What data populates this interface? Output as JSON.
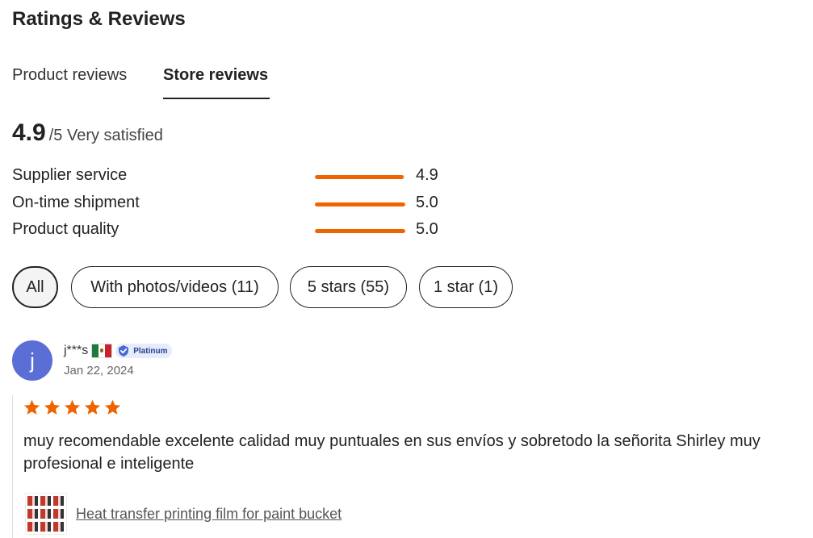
{
  "header": {
    "title": "Ratings & Reviews"
  },
  "tabs": [
    {
      "label": "Product reviews",
      "active": false
    },
    {
      "label": "Store reviews",
      "active": true
    }
  ],
  "summary": {
    "score": "4.9",
    "rest": "/5 Very satisfied"
  },
  "metrics": [
    {
      "label": "Supplier service",
      "value": "4.9",
      "fraction": 0.98
    },
    {
      "label": "On-time shipment",
      "value": "5.0",
      "fraction": 1.0
    },
    {
      "label": "Product quality",
      "value": "5.0",
      "fraction": 1.0
    }
  ],
  "filters": [
    {
      "label": "All",
      "active": true
    },
    {
      "label": "With photos/videos (11)",
      "active": false
    },
    {
      "label": "5 stars (55)",
      "active": false
    },
    {
      "label": "1 star (1)",
      "active": false
    }
  ],
  "review": {
    "avatar_letter": "j",
    "name": "j***s",
    "badge": "Platinum",
    "date": "Jan 22, 2024",
    "stars": 5,
    "text": "muy recomendable excelente calidad muy puntuales en sus envíos y sobretodo la señorita Shirley muy profesional e inteligente",
    "product_title": "Heat transfer printing film for paint bucket"
  },
  "colors": {
    "accent": "#f06400",
    "avatar": "#5a6ed6",
    "badge_bg": "#e6ecfb"
  }
}
